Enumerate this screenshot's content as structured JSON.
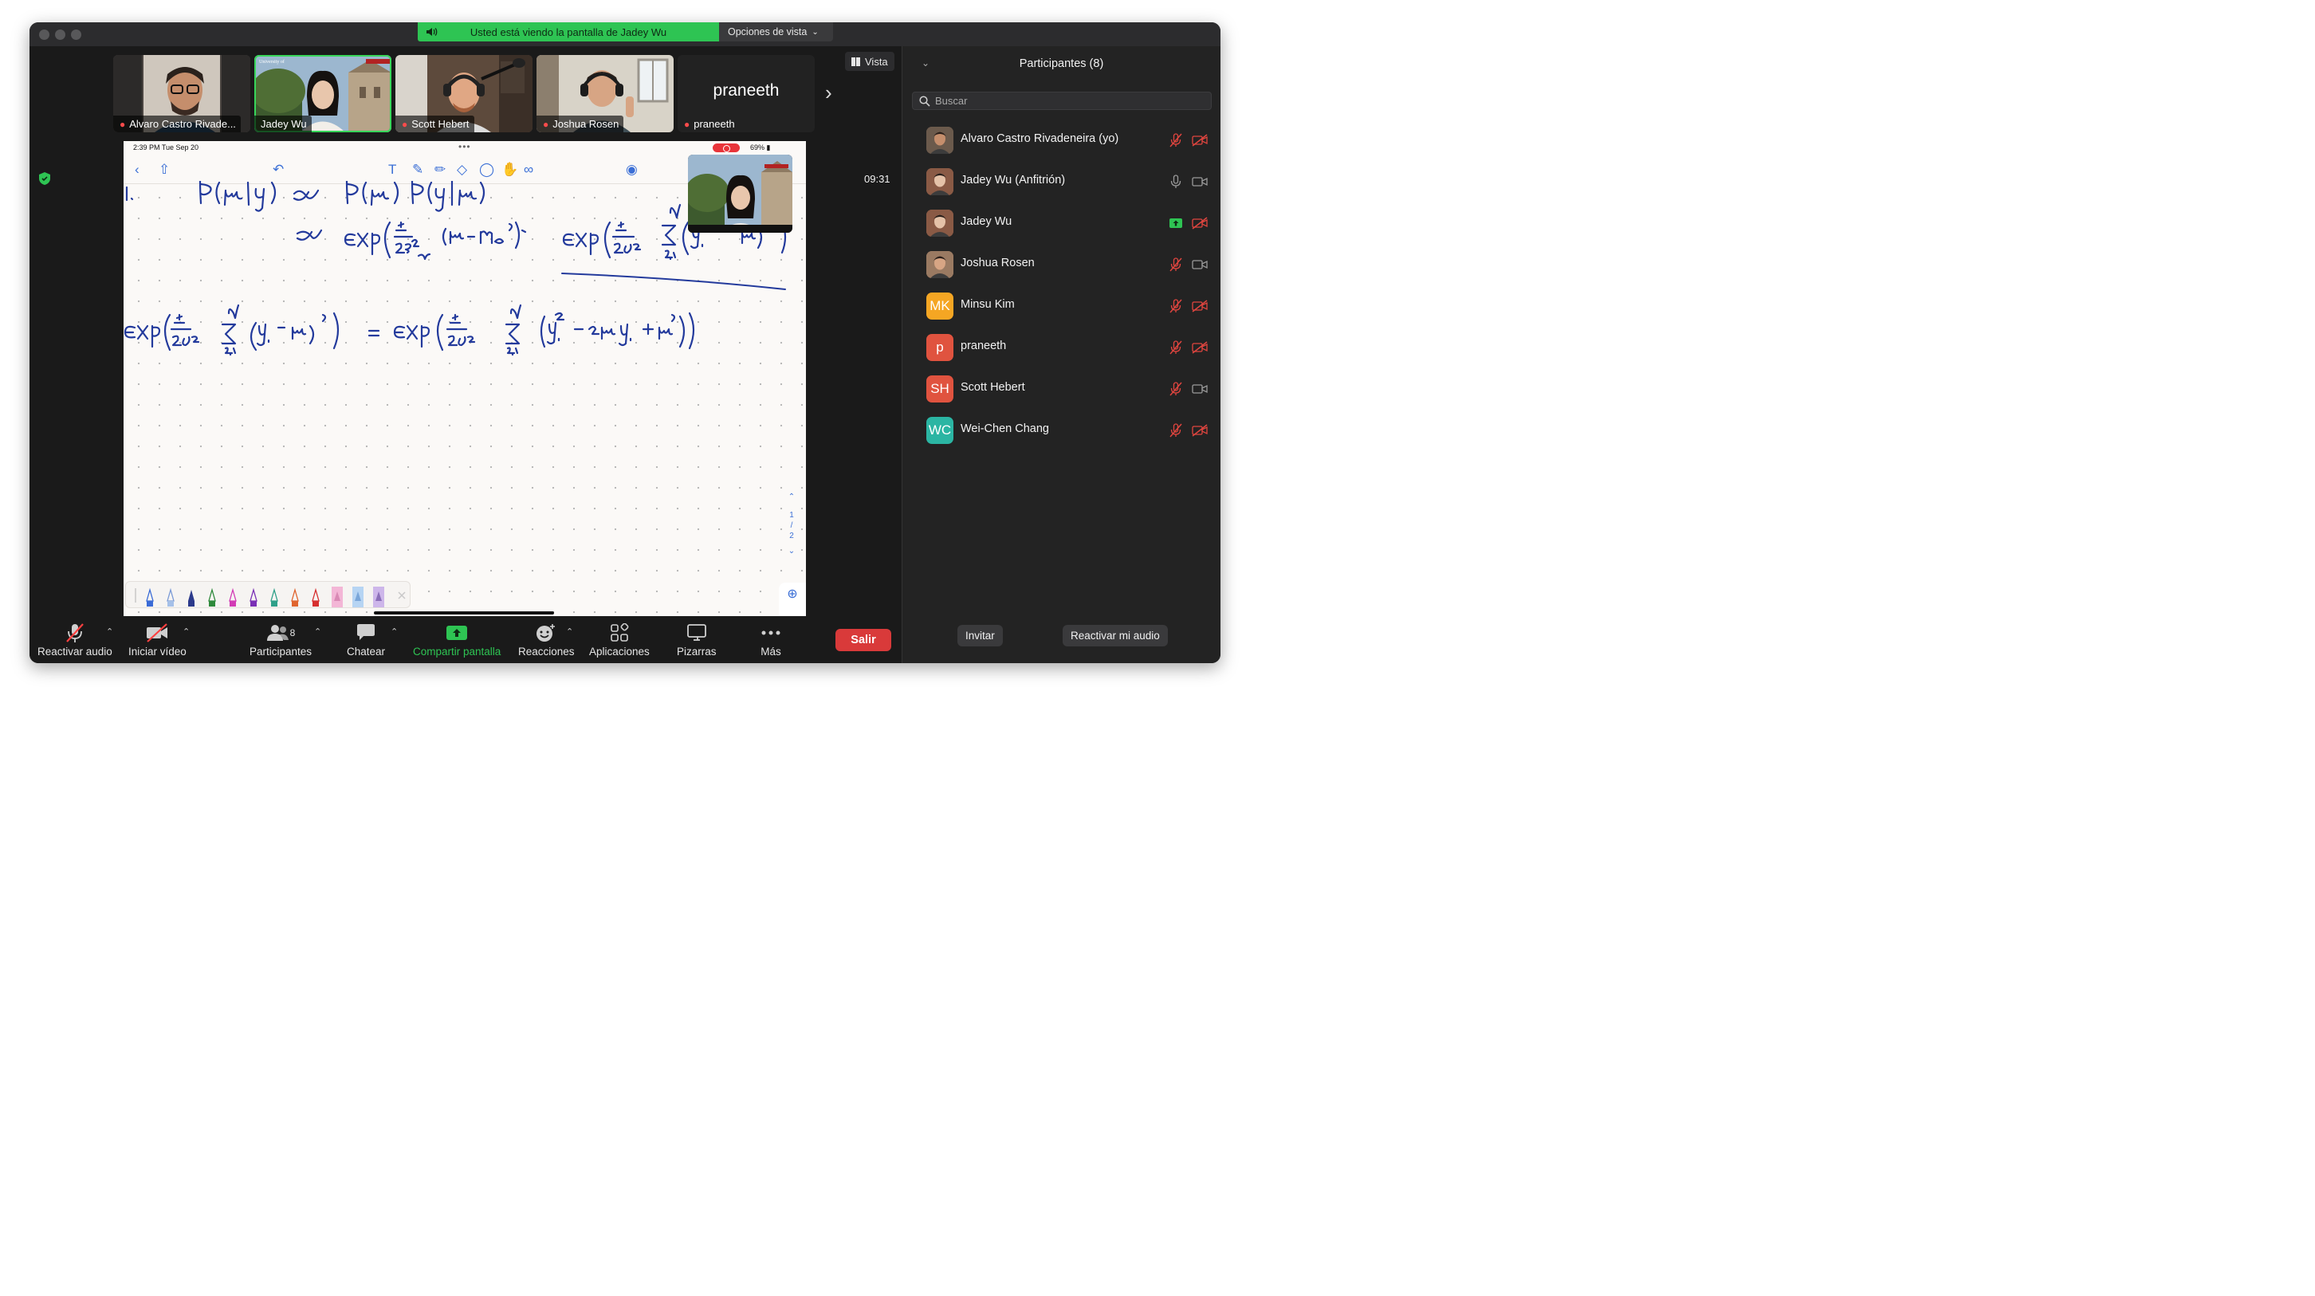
{
  "banner": {
    "text": "Usted está viendo la pantalla de Jadey Wu",
    "view_options": "Opciones de vista"
  },
  "gallery": {
    "tiles": [
      {
        "name": "Alvaro Castro Rivade...",
        "muted": true
      },
      {
        "name": "Jadey Wu",
        "muted": false,
        "active": true
      },
      {
        "name": "Scott Hebert",
        "muted": true
      },
      {
        "name": "Joshua Rosen",
        "muted": true
      },
      {
        "name": "praneeth",
        "muted": true,
        "big_label": "praneeth"
      }
    ],
    "view_button": "Vista"
  },
  "meeting": {
    "timer": "09:31"
  },
  "ipad": {
    "time": "2:39 PM   Tue Sep 20",
    "battery": "69%",
    "pages": [
      "1",
      "2"
    ]
  },
  "participants_panel": {
    "title": "Participantes (8)",
    "search_placeholder": "Buscar",
    "participants": [
      {
        "name": "Alvaro Castro Rivadeneira (yo)",
        "initials": "",
        "color": "#6b5a4c",
        "mic": "muted",
        "cam": "off"
      },
      {
        "name": "Jadey Wu (Anfitrión)",
        "initials": "",
        "color": "#8a5a45",
        "mic": "on",
        "cam": "on"
      },
      {
        "name": "Jadey Wu",
        "initials": "",
        "color": "#8a5a45",
        "mic": "share",
        "cam": "off"
      },
      {
        "name": "Joshua Rosen",
        "initials": "",
        "color": "#9a7a62",
        "mic": "muted",
        "cam": "on"
      },
      {
        "name": "Minsu Kim",
        "initials": "MK",
        "color": "#f5a623",
        "mic": "muted",
        "cam": "off"
      },
      {
        "name": "praneeth",
        "initials": "p",
        "color": "#e0533f",
        "mic": "muted",
        "cam": "off"
      },
      {
        "name": "Scott Hebert",
        "initials": "SH",
        "color": "#e0533f",
        "mic": "muted",
        "cam": "on"
      },
      {
        "name": "Wei-Chen Chang",
        "initials": "WC",
        "color": "#2bb5a3",
        "mic": "muted",
        "cam": "off"
      }
    ],
    "invite": "Invitar",
    "unmute_me": "Reactivar mi audio"
  },
  "toolbar": {
    "unmute": "Reactivar audio",
    "start_video": "Iniciar vídeo",
    "participants": "Participantes",
    "participants_count": "8",
    "chat": "Chatear",
    "share": "Compartir pantalla",
    "reactions": "Reacciones",
    "apps": "Aplicaciones",
    "whiteboards": "Pizarras",
    "more": "Más",
    "leave": "Salir"
  },
  "colors": {
    "accent_green": "#2ec453",
    "leave_red": "#d93a3a",
    "ink_blue": "#233a9c",
    "ipad_blue": "#3b6fd6"
  }
}
